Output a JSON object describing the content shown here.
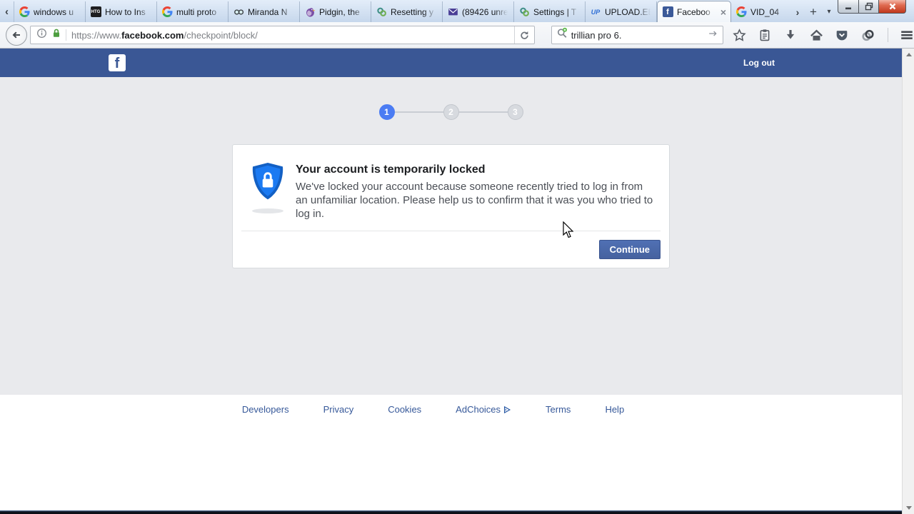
{
  "colors": {
    "facebook_header_blue": "#3a5795",
    "step_active_blue": "#4b7cf3",
    "continue_button_blue": "#4a67ad",
    "footer_link_blue": "#365899",
    "page_background": "#e9eaed",
    "url_lock_green": "#4d9e3f",
    "shield_icon_blue": "#1b7af2"
  },
  "browser": {
    "tab_scroll_left_glyph": "‹",
    "tab_overflow_glyph": "›",
    "new_tab_glyph": "+",
    "all_tabs_glyph": "▾",
    "tab_close_glyph": "×",
    "tabs": [
      {
        "icon": "google-icon",
        "label": "windows u"
      },
      {
        "icon": "howtogeek-icon",
        "label": "How to Ins",
        "badge": "HTG"
      },
      {
        "icon": "google-icon",
        "label": "multi proto"
      },
      {
        "icon": "miranda-icon",
        "label": "Miranda N"
      },
      {
        "icon": "pidgin-icon",
        "label": "Pidgin, the"
      },
      {
        "icon": "trillian-icon",
        "label": "Resetting y"
      },
      {
        "icon": "mail-icon",
        "label": "(89426 unre"
      },
      {
        "icon": "trillian-icon",
        "label": "Settings | T"
      },
      {
        "icon": "uploadee-icon",
        "label": "UPLOAD.EE",
        "badge": "UP"
      },
      {
        "icon": "facebook-icon",
        "label": "Faceboo",
        "badge": "f",
        "active": true
      },
      {
        "icon": "google-icon",
        "label": "VID_04"
      }
    ],
    "url": {
      "prefix": "https://www.",
      "domain": "facebook.com",
      "path": "/checkpoint/block/"
    },
    "search": {
      "value": "trillian pro 6."
    }
  },
  "page": {
    "header": {
      "logo_letter": "f",
      "logout_label": "Log out"
    },
    "stepper": {
      "steps": [
        "1",
        "2",
        "3"
      ],
      "active_step": 1
    },
    "card": {
      "title": "Your account is temporarily locked",
      "body": "We've locked your account because someone recently tried to log in from an unfamiliar location. Please help us to confirm that it was you who tried to log in.",
      "continue_label": "Continue"
    },
    "footer": {
      "links": [
        "Developers",
        "Privacy",
        "Cookies",
        "AdChoices",
        "Terms",
        "Help"
      ]
    }
  }
}
